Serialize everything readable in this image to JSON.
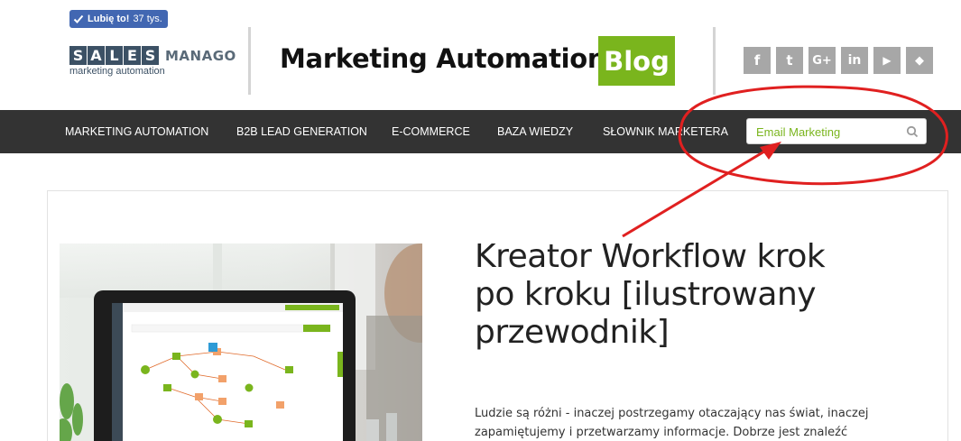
{
  "facebook": {
    "like_label": "Lubię to!",
    "like_count": "37 tys."
  },
  "logo": {
    "letters": [
      "S",
      "A",
      "L",
      "E",
      "S"
    ],
    "word": "MANAGO",
    "tagline": "marketing automation"
  },
  "header": {
    "title": "Marketing Automation",
    "badge": "Blog"
  },
  "social": [
    {
      "icon": "facebook-icon",
      "glyph": "f"
    },
    {
      "icon": "twitter-icon",
      "glyph": "t"
    },
    {
      "icon": "google-plus-icon",
      "glyph": "G+"
    },
    {
      "icon": "linkedin-icon",
      "glyph": "in"
    },
    {
      "icon": "youtube-icon",
      "glyph": "▶"
    },
    {
      "icon": "feedly-icon",
      "glyph": "◆"
    }
  ],
  "nav": {
    "items": [
      {
        "label": "MARKETING AUTOMATION"
      },
      {
        "label": "B2B LEAD GENERATION"
      },
      {
        "label": "E-COMMERCE"
      },
      {
        "label": "BAZA WIEDZY"
      },
      {
        "label": "SŁOWNIK MARKETERA"
      }
    ],
    "search": {
      "value": "Email Marketing",
      "icon": "search-icon"
    }
  },
  "article": {
    "title": "Kreator Workflow krok po kroku [ilustrowany przewodnik]",
    "excerpt": "Ludzie są różni - inaczej postrzegamy otaczający nas świat, inaczej zapamiętujemy i przetwarzamy informacje. Dobrze jest znaleźć sposób,"
  },
  "colors": {
    "accent": "#7ab51d",
    "nav_bg": "#333333",
    "annotation": "#e02020",
    "fb": "#4267b2"
  }
}
